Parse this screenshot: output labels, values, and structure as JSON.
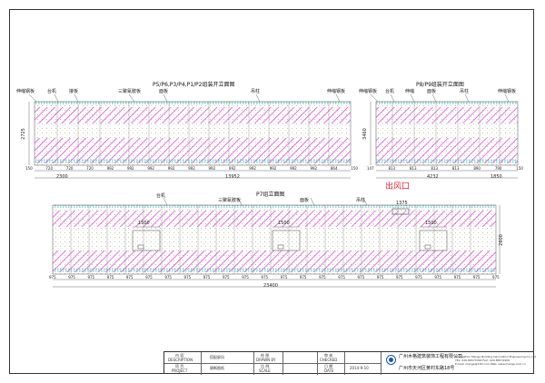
{
  "drawing": {
    "view1": {
      "title": "P5/P6,P3/P4,P1/P2组装开立面图",
      "labels": [
        "伸缩钢板",
        "台机",
        "接板",
        "三聚氰胺板",
        "面板",
        "吊柱",
        "伸缩钢板"
      ],
      "height_dim": "2725",
      "bottom_dims": [
        "150",
        "720",
        "720",
        "720",
        "992",
        "992",
        "992",
        "992",
        "992",
        "992",
        "992",
        "992",
        "992",
        "992",
        "992",
        "864",
        "150"
      ],
      "totals": [
        "2300",
        "13952"
      ]
    },
    "view2": {
      "title": "P8/P9组装开立面图",
      "labels": [
        "伸缩钢板",
        "台机",
        "伸缩",
        "面板",
        "吊柱",
        "伸缩钢板"
      ],
      "height_dim": "3460",
      "bottom_dims": [
        "147",
        "813",
        "813",
        "813",
        "813",
        "890",
        "790",
        "150"
      ],
      "totals": [
        "4232",
        "1850"
      ]
    },
    "view3": {
      "title": "P7组立面图",
      "labels": [
        "台机",
        "三聚氰胺板",
        "面板",
        "吊柱"
      ],
      "outlet_label": "出风口",
      "outlet_dim": "1375",
      "opening_dims": [
        "1500",
        "1500",
        "1500"
      ],
      "height_dim": "2600",
      "bottom_dims": [
        "975",
        "975",
        "975",
        "975",
        "975",
        "975",
        "975",
        "975",
        "975",
        "975",
        "975",
        "975",
        "975",
        "975",
        "975",
        "975",
        "975",
        "975",
        "975",
        "975",
        "975",
        "975",
        "975",
        "975"
      ],
      "total": "23400"
    }
  },
  "title_block": {
    "description_cn": "内 容",
    "description_en": "DESCRIPTION",
    "description_value": "搭配屏风",
    "project_cn": "项 目",
    "project_en": "PROJECT",
    "project_value": "隔断图纸",
    "drawn_cn": "绘 图",
    "drawn_en": "DRAWN BY",
    "scale_cn": "比 例",
    "scale_en": "SCALE",
    "checked_cn": "审 核",
    "checked_en": "CHECKED",
    "date_cn": "日 期",
    "date_en": "DATE",
    "date_value": "2014-9-10",
    "company_cn": "广州木格建筑装饰工程有限公司",
    "company_en": "Guangzhou Mange Building Decoration Engineering Co.,Ltd",
    "tel": "TEL: 020-86573399  FAX: 020-86572909",
    "email": "E-mail: mange@163.com  Web: www.mange.com.cn",
    "address": "广州市天河区黄村东路18号"
  }
}
